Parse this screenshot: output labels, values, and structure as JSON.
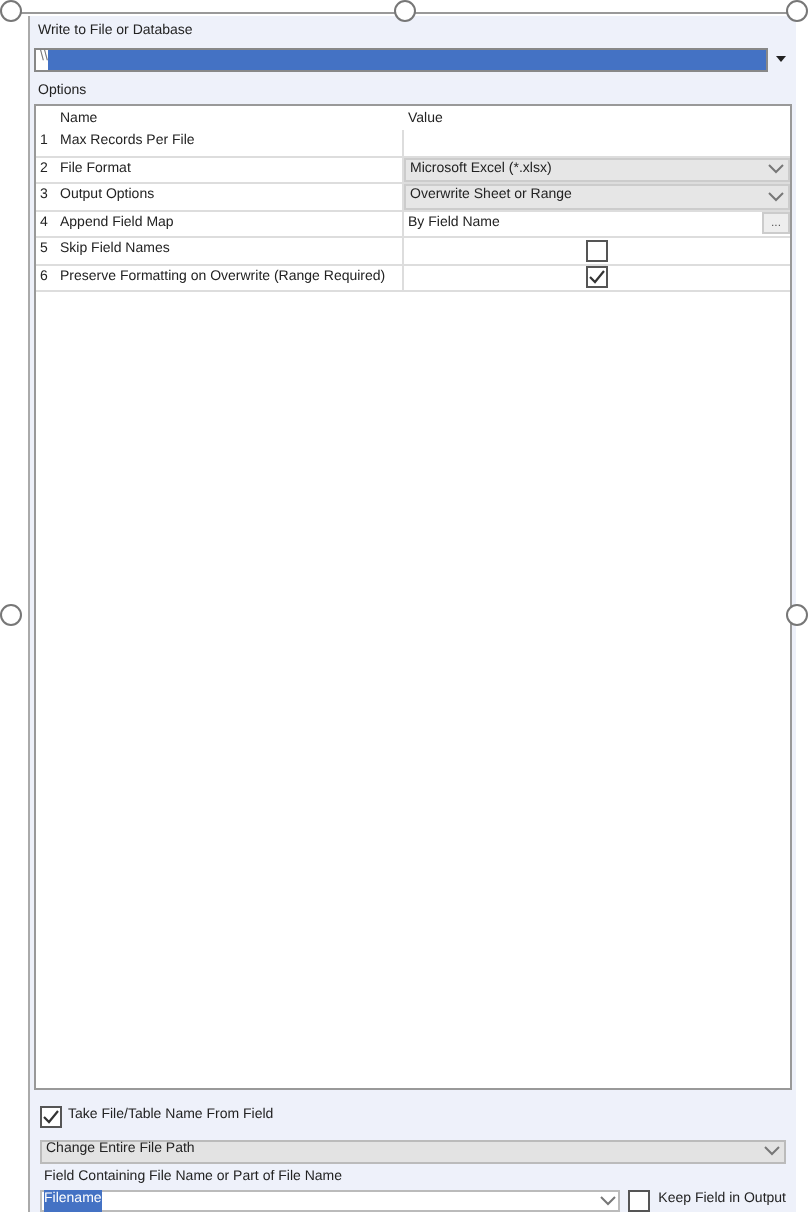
{
  "section_title": "Write to File or Database",
  "path_field": {
    "value": "\\\\",
    "selected": true
  },
  "options": {
    "title": "Options",
    "columns": [
      "Name",
      "Value"
    ],
    "rows": [
      {
        "index": "1",
        "name": "Max Records Per File",
        "kind": "text"
      },
      {
        "index": "2",
        "name": "File Format",
        "kind": "dropdown",
        "value": "Microsoft Excel (*.xlsx)"
      },
      {
        "index": "3",
        "name": "Output Options",
        "kind": "dropdown",
        "value": "Overwrite Sheet or Range"
      },
      {
        "index": "4",
        "name": "Append Field Map",
        "kind": "browse",
        "value": "By Field Name",
        "button": "..."
      },
      {
        "index": "5",
        "name": "Skip Field Names",
        "kind": "checkbox",
        "checked": false
      },
      {
        "index": "6",
        "name": "Preserve Formatting on Overwrite (Range Required)",
        "kind": "checkbox",
        "checked": true
      }
    ]
  },
  "take_name": {
    "label": "Take File/Table Name From Field",
    "checked": true
  },
  "mode_dropdown": {
    "value": "Change Entire File Path"
  },
  "field_label": "Field Containing File Name or Part of File Name",
  "field_dropdown": {
    "value": "Filename",
    "selected": true
  },
  "keep_field": {
    "label": "Keep Field in Output",
    "checked": false
  }
}
